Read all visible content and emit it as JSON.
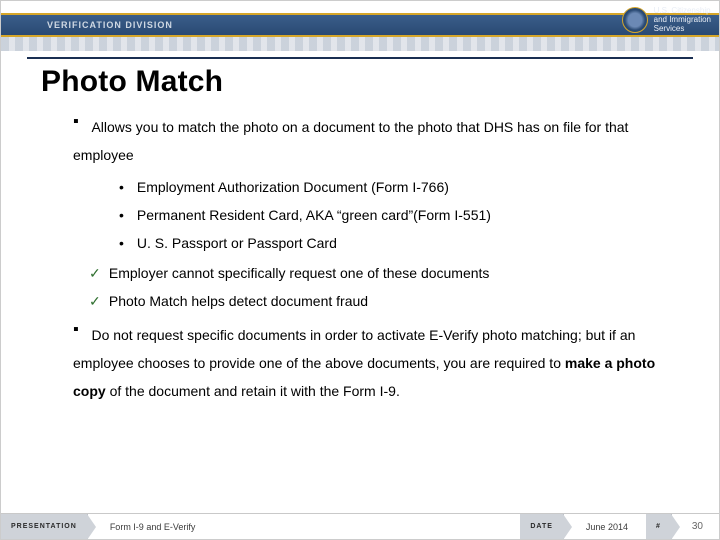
{
  "header": {
    "division": "VERIFICATION DIVISION",
    "agency_line1": "U.S. Citizenship",
    "agency_line2": "and Immigration",
    "agency_line3": "Services"
  },
  "title": "Photo Match",
  "bullets": {
    "b1": "Allows you to match the photo on a document to the photo that DHS has on file for that employee",
    "sub": [
      "Employment Authorization Document (Form I-766)",
      "Permanent Resident Card, AKA “green card”(Form I-551)",
      "U. S. Passport or Passport Card"
    ],
    "checks": [
      "Employer cannot specifically request one of these documents",
      "Photo Match helps detect document fraud"
    ],
    "b2_pre": "Do not request specific documents in order to activate E-Verify photo matching; but if an employee chooses to provide one of the above documents, you are required to ",
    "b2_bold": "make a photo copy",
    "b2_post": " of the document and retain it with the Form I-9."
  },
  "footer": {
    "label_presentation": "PRESENTATION",
    "presentation": "Form I-9 and E-Verify",
    "label_date": "DATE",
    "date": "June 2014",
    "label_num": "#",
    "page": "30"
  },
  "glyphs": {
    "square": "▪",
    "dot": "•",
    "check": "✓"
  }
}
